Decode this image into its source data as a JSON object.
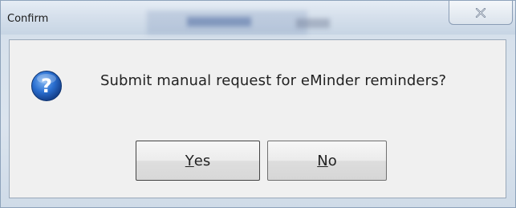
{
  "window": {
    "title": "Confirm",
    "close_tooltip_glyph": "close-icon"
  },
  "dialog": {
    "icon": "question-icon",
    "message": "Submit manual request for eMinder reminders?",
    "buttons": {
      "yes": {
        "mnemonic": "Y",
        "rest": "es"
      },
      "no": {
        "mnemonic": "N",
        "rest": "o"
      }
    }
  },
  "colors": {
    "icon_blue": "#1f5fb8",
    "default_focus": "#3c7fb1",
    "client_bg": "#f0f0f0"
  }
}
